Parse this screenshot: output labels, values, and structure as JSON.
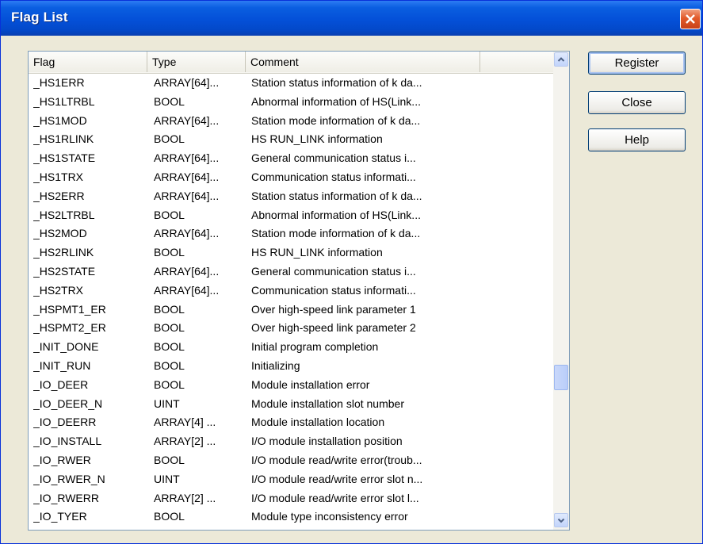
{
  "window": {
    "title": "Flag List"
  },
  "list": {
    "columns": [
      "Flag",
      "Type",
      "Comment",
      ""
    ],
    "rows": [
      {
        "flag": "_HS1ERR",
        "type": "ARRAY[64]...",
        "comment": "Station status information of k da..."
      },
      {
        "flag": "_HS1LTRBL",
        "type": "BOOL",
        "comment": "Abnormal information of HS(Link..."
      },
      {
        "flag": "_HS1MOD",
        "type": "ARRAY[64]...",
        "comment": "Station mode information of k da..."
      },
      {
        "flag": "_HS1RLINK",
        "type": "BOOL",
        "comment": "HS RUN_LINK information"
      },
      {
        "flag": "_HS1STATE",
        "type": "ARRAY[64]...",
        "comment": "General communication status i..."
      },
      {
        "flag": "_HS1TRX",
        "type": "ARRAY[64]...",
        "comment": "Communication status informati..."
      },
      {
        "flag": "_HS2ERR",
        "type": "ARRAY[64]...",
        "comment": "Station status information of k da..."
      },
      {
        "flag": "_HS2LTRBL",
        "type": "BOOL",
        "comment": "Abnormal information of HS(Link..."
      },
      {
        "flag": "_HS2MOD",
        "type": "ARRAY[64]...",
        "comment": "Station mode information of k da..."
      },
      {
        "flag": "_HS2RLINK",
        "type": "BOOL",
        "comment": "HS RUN_LINK information"
      },
      {
        "flag": "_HS2STATE",
        "type": "ARRAY[64]...",
        "comment": "General communication status i..."
      },
      {
        "flag": "_HS2TRX",
        "type": "ARRAY[64]...",
        "comment": "Communication status informati..."
      },
      {
        "flag": "_HSPMT1_ER",
        "type": "BOOL",
        "comment": "Over high-speed link parameter 1"
      },
      {
        "flag": "_HSPMT2_ER",
        "type": "BOOL",
        "comment": "Over high-speed link parameter 2"
      },
      {
        "flag": "_INIT_DONE",
        "type": "BOOL",
        "comment": "Initial program completion"
      },
      {
        "flag": "_INIT_RUN",
        "type": "BOOL",
        "comment": "Initializing"
      },
      {
        "flag": "_IO_DEER",
        "type": "BOOL",
        "comment": "Module installation error"
      },
      {
        "flag": "_IO_DEER_N",
        "type": "UINT",
        "comment": "Module installation slot number"
      },
      {
        "flag": "_IO_DEERR",
        "type": "ARRAY[4] ...",
        "comment": "Module installation location"
      },
      {
        "flag": "_IO_INSTALL",
        "type": "ARRAY[2] ...",
        "comment": "I/O module installation position"
      },
      {
        "flag": "_IO_RWER",
        "type": "BOOL",
        "comment": "I/O module read/write error(troub..."
      },
      {
        "flag": "_IO_RWER_N",
        "type": "UINT",
        "comment": "I/O module read/write error slot n..."
      },
      {
        "flag": "_IO_RWERR",
        "type": "ARRAY[2] ...",
        "comment": "I/O module read/write error slot l..."
      },
      {
        "flag": "_IO_TYER",
        "type": "BOOL",
        "comment": "Module type inconsistency error"
      }
    ]
  },
  "buttons": {
    "register": "Register",
    "close": "Close",
    "help": "Help"
  },
  "icons": {
    "close": "close-icon",
    "scroll_up": "arrow-up-icon",
    "scroll_down": "arrow-down-icon"
  },
  "colors": {
    "titlebar": "#0450d8",
    "close": "#e25a2a",
    "selection_border": "#003c74"
  }
}
